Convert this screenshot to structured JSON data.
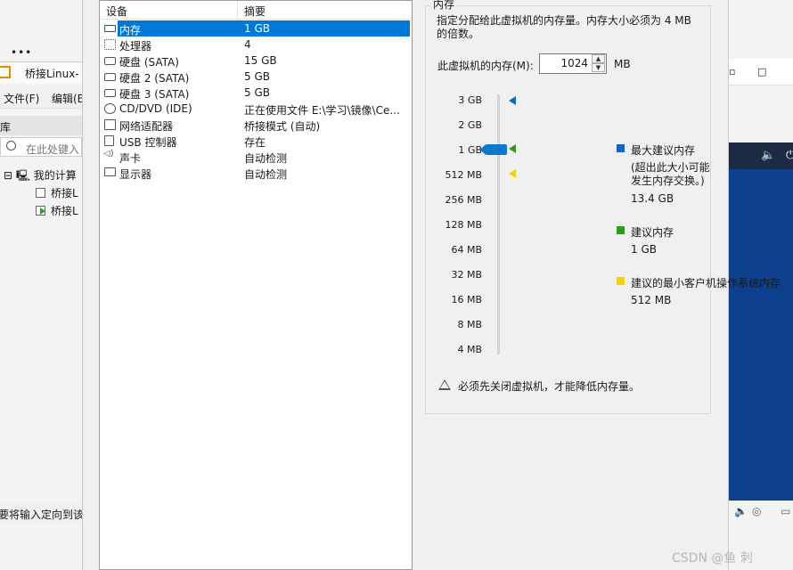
{
  "background_window": {
    "vm_title": "桥接Linux-",
    "menu_file": "文件(F)",
    "menu_edit": "编辑(E",
    "library_header": "库",
    "search_placeholder": "在此处键入",
    "tree_root": "我的计算",
    "tree_children": [
      "桥接L",
      "桥接L"
    ],
    "status_text": "要将输入定向到该",
    "more_icon": "•••"
  },
  "device_table": {
    "col_device": "设备",
    "col_summary": "摘要",
    "rows": [
      {
        "name": "内存",
        "value": "1 GB",
        "icon": "memory-icon",
        "selected": true
      },
      {
        "name": "处理器",
        "value": "4",
        "icon": "cpu-icon"
      },
      {
        "name": "硬盘 (SATA)",
        "value": "15 GB",
        "icon": "hard-disk-icon"
      },
      {
        "name": "硬盘 2 (SATA)",
        "value": "5 GB",
        "icon": "hard-disk-icon"
      },
      {
        "name": "硬盘 3 (SATA)",
        "value": "5 GB",
        "icon": "hard-disk-icon"
      },
      {
        "name": "CD/DVD (IDE)",
        "value": "正在使用文件 E:\\学习\\镜像\\Ce...",
        "icon": "cd-dvd-icon"
      },
      {
        "name": "网络适配器",
        "value": "桥接模式 (自动)",
        "icon": "network-adapter-icon"
      },
      {
        "name": "USB 控制器",
        "value": "存在",
        "icon": "usb-icon"
      },
      {
        "name": "声卡",
        "value": "自动检测",
        "icon": "sound-card-icon"
      },
      {
        "name": "显示器",
        "value": "自动检测",
        "icon": "monitor-icon"
      }
    ]
  },
  "memory_panel": {
    "group_title": "内存",
    "description": "指定分配给此虚拟机的内存量。内存大小必须为 4 MB 的倍数。",
    "memory_label": "此虚拟机的内存(M):",
    "memory_value": "1024",
    "memory_unit": "MB",
    "scale_ticks": [
      "3 GB",
      "2 GB",
      "1 GB",
      "512 MB",
      "256 MB",
      "128 MB",
      "64 MB",
      "32 MB",
      "16 MB",
      "8 MB",
      "4 MB"
    ],
    "legend": {
      "max_title": "最大建议内存",
      "max_note_1": "(超出此大小可能",
      "max_note_2": "发生内存交换。)",
      "max_value": "13.4 GB",
      "rec_title": "建议内存",
      "rec_value": "1 GB",
      "min_title": "建议的最小客户机操作系统内存",
      "min_value": "512 MB"
    },
    "colors": {
      "max": "#1565c0",
      "recommended": "#2e9b1e",
      "minimum": "#f3d400",
      "selection": "#0078d7"
    },
    "warning": "必须先关闭虚拟机，才能降低内存量。"
  },
  "watermark": "CSDN @鱼    刺"
}
